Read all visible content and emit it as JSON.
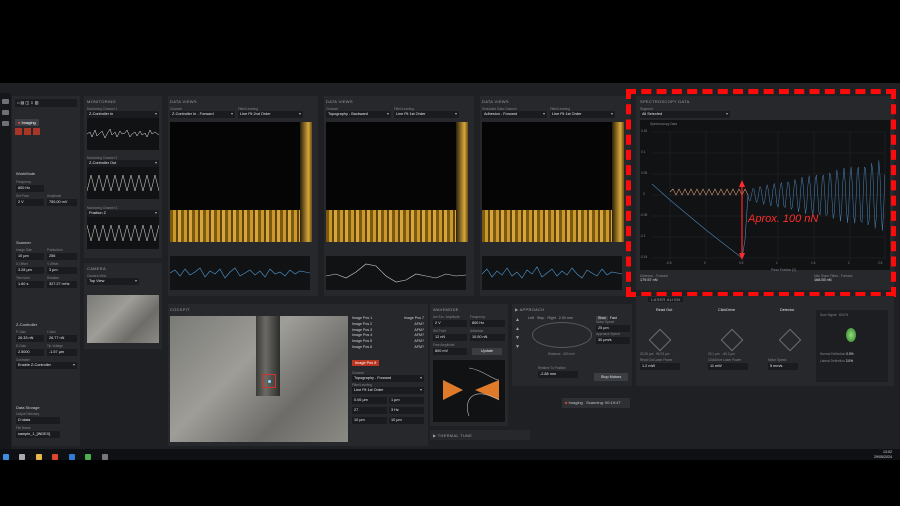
{
  "app": {
    "tab_label": "Nanosurf Studio",
    "window_title": "NANOSURF STUDIO — EXPERIMENT",
    "logo": "NS"
  },
  "left": {
    "imaging_label": "Imaging",
    "monitoring_title": "MONITORING",
    "workmode_title": "WorkMode",
    "freq_label": "Frequency",
    "freq_val": "800 Hz",
    "setpoint_label": "Set Point",
    "setpoint_val": "2 V",
    "amp_label": "Amplitude",
    "amp_val": "750.00 mV",
    "scanner_title": "Scanner",
    "imagesize_label": "Image Size",
    "imagesize_val": "10 µm",
    "points_label": "Points/Line",
    "points_val": "256",
    "xoff_label": "X-Offset",
    "xoff_val": "3.28 µm",
    "yoff_label": "Y-Offset",
    "yoff_val": "3 µm",
    "time_label": "Time/Line",
    "time_val": "1.60 s",
    "rot_label": "Rotation",
    "rot_val": "327.27 mHz",
    "zctrl_title": "Z-Controller",
    "pgain_label": "P-Gain",
    "pgain_val": "26.33 nN",
    "igain_label": "I-Gain",
    "igain_val": "26.77 nN",
    "dgain_label": "D-Gain",
    "dgain_val": "2.5000",
    "tipv_label": "Tip Voltage",
    "tipv_val": "-1.57 µm",
    "ctrl_label": "Controller",
    "ctrl_val": "Enable Z-Controller",
    "storage_title": "Data Storage",
    "dir_label": "Output Directory",
    "dir_val": "D:\\data",
    "file_label": "File Name",
    "file_val": "sample_1_[INDEX]"
  },
  "monitoring": {
    "ch1_label": "Monitoring Channel 1",
    "ch1_val": "Z-Controller In",
    "ch2_label": "Monitoring Channel 2",
    "ch2_val": "Z-Controller Out",
    "ch3_label": "Monitoring Channel 3",
    "ch3_val": "Position Z"
  },
  "dataviews": [
    {
      "title": "DATA VIEWS",
      "ch_label": "Channel",
      "ch_val": "Z-Controller In - Forward",
      "filt_label": "Filter/Leveling",
      "filt_val": "Line Fit 2nd Order"
    },
    {
      "title": "DATA VIEWS",
      "ch_label": "Channel",
      "ch_val": "Topography - Backward",
      "filt_label": "Filter/Leveling",
      "filt_val": "Line Fit 1st Order"
    },
    {
      "title": "DATA VIEWS",
      "ch_label": "Simulated Data Channel",
      "ch_val": "Adhesion - Forward",
      "filt_label": "Filter/Leveling",
      "filt_val": "Line Fit 1st Order"
    }
  ],
  "spectro": {
    "title": "SPECTROSCOPY DATA",
    "seg_label": "Segment",
    "seg_val": "All Selected",
    "inner": "Spectroscopy Data",
    "yticks": [
      "0.15",
      "0.1",
      "0.05",
      "0",
      "-0.05",
      "-0.1",
      "-0.15"
    ],
    "xticks": [
      "-0.5",
      "0",
      "0.5",
      "1",
      "1.5",
      "2",
      "2.5"
    ],
    "xlabel": "Piezo Position [V]",
    "adh_label": "Adhesion - Forward",
    "adh_val": "179.57 nN",
    "slope_label": "Max Slope Fitted - Forward",
    "slope_val": "168.55 nN"
  },
  "camera": {
    "title": "CAMERA",
    "cam_label": "Camera View",
    "cam_val": "Top View"
  },
  "cockpit": {
    "title": "COCKPIT"
  },
  "imagepos": {
    "items": [
      "Image Pos 1",
      "Image Pos 2",
      "Image Pos 3",
      "Image Pos 4",
      "Image Pos 5",
      "Image Pos 6"
    ],
    "items2": [
      "Image Pos 7",
      "AFM?",
      "AFM?",
      "AFM?",
      "AFM?",
      "AFM?"
    ],
    "btn": "Image Pos 8",
    "ch_label": "Channel",
    "ch_val": "Topography - Forward",
    "filt_label": "Filter/Leveling",
    "filt_val": "Line Fit 1st Order",
    "pos1": "0.06 µm",
    "pos2": "1 µm",
    "pos3": "27",
    "pos4": "3 Hz",
    "pos5": "10 µm",
    "pos6": "10 µm"
  },
  "waveform": {
    "title": "WAVEMODE",
    "amp_label": "Am Exc. Amplitude",
    "amp_val": "2 V",
    "freq_label": "Frequency",
    "freq_val": "800 Hz",
    "setp_label": "Set Point",
    "setp_val": "12 nN",
    "adh_label": "Adhesion",
    "adh_val": "10.00 nN",
    "sp_label": "Free Amplitude",
    "sp_val": "800 mV",
    "update": "Update"
  },
  "approach": {
    "title": "APPROACH",
    "left": "Left",
    "step": "Step",
    "right": "Right",
    "speed": "2.00 mm",
    "ms": "Slow",
    "fast": "Fast",
    "mf_label": "Motor Speed",
    "mf_val": "25 µm",
    "ap_label": "Approach Speed",
    "ap_val": "30 µm/s",
    "dist_label": "Distance",
    "dist_val": "-400 mm",
    "stop": "Stop Motors",
    "relative_label": "Relative To Position",
    "relative_val": "-2.88 mm"
  },
  "laser": {
    "title": "LASER ALIGN",
    "readout": "Read Out",
    "clickdrive": "ClickDrive",
    "detector": "Detector",
    "ro_val": "20.26 µm",
    "ro_val2": "96.03 µm",
    "cd_val": "20.1 µm",
    "cd_val2": "-60.2 µm",
    "rl_label": "Read Out Laser Power",
    "rl_val": "1.2 mW",
    "cd_label": "ClickDrive Laser Power",
    "cd_val3": "11 mW",
    "sig_label": "Sum Signal",
    "sig_val": "60.0%",
    "norm_label": "Normal Deflection",
    "norm_val": "0.0%",
    "lat_label": "Lateral Deflection",
    "lat_val": "2.0%",
    "ms_label": "Motor Speed",
    "ms_val": "5 mm/s"
  },
  "status": {
    "imaging": "Imaging",
    "scan": "Scanning: 00:19:47"
  },
  "thermal": {
    "title": "THERMAL TUNE"
  },
  "annotation": "Aprox. 100 nN",
  "taskbar": {
    "time": "13:02",
    "date": "29/05/2024"
  }
}
